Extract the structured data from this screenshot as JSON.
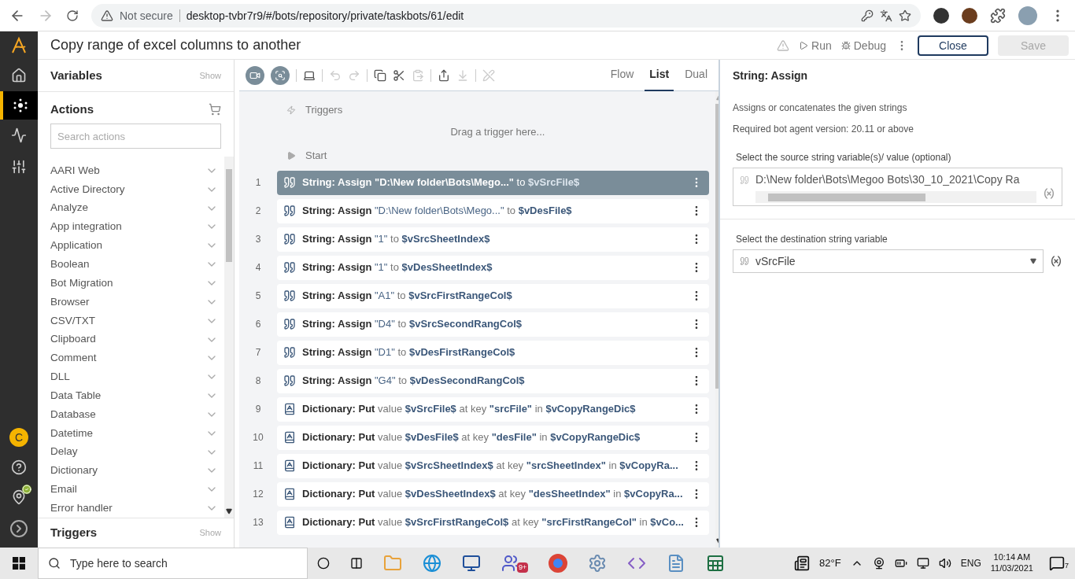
{
  "browser": {
    "security": "Not secure",
    "url": "desktop-tvbr7r9/#/bots/repository/private/taskbots/61/edit"
  },
  "header": {
    "title": "Copy range of excel columns to another",
    "run": "Run",
    "debug": "Debug",
    "close": "Close",
    "save": {
      "label": "Save",
      "disabled": true
    }
  },
  "rail": {
    "avatar": "C"
  },
  "variables_panel": {
    "title": "Variables",
    "toggle": "Show"
  },
  "actions_panel": {
    "title": "Actions",
    "search_placeholder": "Search actions",
    "items": [
      "AARI Web",
      "Active Directory",
      "Analyze",
      "App integration",
      "Application",
      "Boolean",
      "Bot Migration",
      "Browser",
      "CSV/TXT",
      "Clipboard",
      "Comment",
      "DLL",
      "Data Table",
      "Database",
      "Datetime",
      "Delay",
      "Dictionary",
      "Email",
      "Error handler"
    ]
  },
  "triggers_panel": {
    "title": "Triggers",
    "toggle": "Show"
  },
  "editor": {
    "tabs": [
      {
        "label": "Flow",
        "selected": false
      },
      {
        "label": "List",
        "selected": true
      },
      {
        "label": "Dual",
        "selected": false
      }
    ],
    "triggers_label": "Triggers",
    "drop_hint": "Drag a trigger here...",
    "start_label": "Start",
    "rows": [
      {
        "number": "1",
        "selected": true,
        "kind": "string",
        "parts": [
          {
            "kind": "action",
            "text": "String: Assign"
          },
          {
            "kind": "literal",
            "text": "\"D:\\New folder\\Bots\\Mego...\""
          },
          {
            "kind": "plain",
            "text": "to"
          },
          {
            "kind": "variable",
            "text": "$vSrcFile$"
          }
        ]
      },
      {
        "number": "2",
        "selected": false,
        "kind": "string",
        "parts": [
          {
            "kind": "action",
            "text": "String: Assign"
          },
          {
            "kind": "literal",
            "text": "\"D:\\New folder\\Bots\\Mego...\""
          },
          {
            "kind": "plain",
            "text": "to"
          },
          {
            "kind": "variable",
            "text": "$vDesFile$"
          }
        ]
      },
      {
        "number": "3",
        "selected": false,
        "kind": "string",
        "parts": [
          {
            "kind": "action",
            "text": "String: Assign"
          },
          {
            "kind": "literal",
            "text": "\"1\""
          },
          {
            "kind": "plain",
            "text": "to"
          },
          {
            "kind": "variable",
            "text": "$vSrcSheetIndex$"
          }
        ]
      },
      {
        "number": "4",
        "selected": false,
        "kind": "string",
        "parts": [
          {
            "kind": "action",
            "text": "String: Assign"
          },
          {
            "kind": "literal",
            "text": "\"1\""
          },
          {
            "kind": "plain",
            "text": "to"
          },
          {
            "kind": "variable",
            "text": "$vDesSheetIndex$"
          }
        ]
      },
      {
        "number": "5",
        "selected": false,
        "kind": "string",
        "parts": [
          {
            "kind": "action",
            "text": "String: Assign"
          },
          {
            "kind": "literal",
            "text": "\"A1\""
          },
          {
            "kind": "plain",
            "text": "to"
          },
          {
            "kind": "variable",
            "text": "$vSrcFirstRangeCol$"
          }
        ]
      },
      {
        "number": "6",
        "selected": false,
        "kind": "string",
        "parts": [
          {
            "kind": "action",
            "text": "String: Assign"
          },
          {
            "kind": "literal",
            "text": "\"D4\""
          },
          {
            "kind": "plain",
            "text": "to"
          },
          {
            "kind": "variable",
            "text": "$vSrcSecondRangCol$"
          }
        ]
      },
      {
        "number": "7",
        "selected": false,
        "kind": "string",
        "parts": [
          {
            "kind": "action",
            "text": "String: Assign"
          },
          {
            "kind": "literal",
            "text": "\"D1\""
          },
          {
            "kind": "plain",
            "text": "to"
          },
          {
            "kind": "variable",
            "text": "$vDesFirstRangeCol$"
          }
        ]
      },
      {
        "number": "8",
        "selected": false,
        "kind": "string",
        "parts": [
          {
            "kind": "action",
            "text": "String: Assign"
          },
          {
            "kind": "literal",
            "text": "\"G4\""
          },
          {
            "kind": "plain",
            "text": "to"
          },
          {
            "kind": "variable",
            "text": "$vDesSecondRangCol$"
          }
        ]
      },
      {
        "number": "9",
        "selected": false,
        "kind": "dictionary",
        "parts": [
          {
            "kind": "action",
            "text": "Dictionary: Put"
          },
          {
            "kind": "plain",
            "text": "value"
          },
          {
            "kind": "variable",
            "text": "$vSrcFile$"
          },
          {
            "kind": "plain",
            "text": "at key"
          },
          {
            "kind": "key",
            "text": "\"srcFile\""
          },
          {
            "kind": "plain",
            "text": "in"
          },
          {
            "kind": "variable",
            "text": "$vCopyRangeDic$"
          }
        ]
      },
      {
        "number": "10",
        "selected": false,
        "kind": "dictionary",
        "parts": [
          {
            "kind": "action",
            "text": "Dictionary: Put"
          },
          {
            "kind": "plain",
            "text": "value"
          },
          {
            "kind": "variable",
            "text": "$vDesFile$"
          },
          {
            "kind": "plain",
            "text": "at key"
          },
          {
            "kind": "key",
            "text": "\"desFile\""
          },
          {
            "kind": "plain",
            "text": "in"
          },
          {
            "kind": "variable",
            "text": "$vCopyRangeDic$"
          }
        ]
      },
      {
        "number": "11",
        "selected": false,
        "kind": "dictionary",
        "parts": [
          {
            "kind": "action",
            "text": "Dictionary: Put"
          },
          {
            "kind": "plain",
            "text": "value"
          },
          {
            "kind": "variable",
            "text": "$vSrcSheetIndex$"
          },
          {
            "kind": "plain",
            "text": "at key"
          },
          {
            "kind": "key",
            "text": "\"srcSheetIndex\""
          },
          {
            "kind": "plain",
            "text": "in"
          },
          {
            "kind": "variable",
            "text": "$vCopyRa..."
          }
        ]
      },
      {
        "number": "12",
        "selected": false,
        "kind": "dictionary",
        "parts": [
          {
            "kind": "action",
            "text": "Dictionary: Put"
          },
          {
            "kind": "plain",
            "text": "value"
          },
          {
            "kind": "variable",
            "text": "$vDesSheetIndex$"
          },
          {
            "kind": "plain",
            "text": "at key"
          },
          {
            "kind": "key",
            "text": "\"desSheetIndex\""
          },
          {
            "kind": "plain",
            "text": "in"
          },
          {
            "kind": "variable",
            "text": "$vCopyRa..."
          }
        ]
      },
      {
        "number": "13",
        "selected": false,
        "kind": "dictionary",
        "parts": [
          {
            "kind": "action",
            "text": "Dictionary: Put"
          },
          {
            "kind": "plain",
            "text": "value"
          },
          {
            "kind": "variable",
            "text": "$vSrcFirstRangeCol$"
          },
          {
            "kind": "plain",
            "text": "at key"
          },
          {
            "kind": "key",
            "text": "\"srcFirstRangeCol\""
          },
          {
            "kind": "plain",
            "text": "in"
          },
          {
            "kind": "variable",
            "text": "$vCo..."
          }
        ]
      }
    ]
  },
  "properties": {
    "title": "String: Assign",
    "description": "Assigns or concatenates the given strings",
    "version": "Required bot agent version: 20.11 or above",
    "source": {
      "label": "Select the source string variable(s)/ value (optional)",
      "value": "D:\\New folder\\Bots\\Megoo Bots\\30_10_2021\\Copy Ra"
    },
    "destination": {
      "label": "Select the destination string variable",
      "value": "vSrcFile"
    }
  },
  "taskbar": {
    "search_placeholder": "Type here to search",
    "teams_badge": "9+",
    "weather": "82°F",
    "language": "ENG",
    "time": "10:14 AM",
    "date": "11/03/2021",
    "notifications": "7"
  }
}
